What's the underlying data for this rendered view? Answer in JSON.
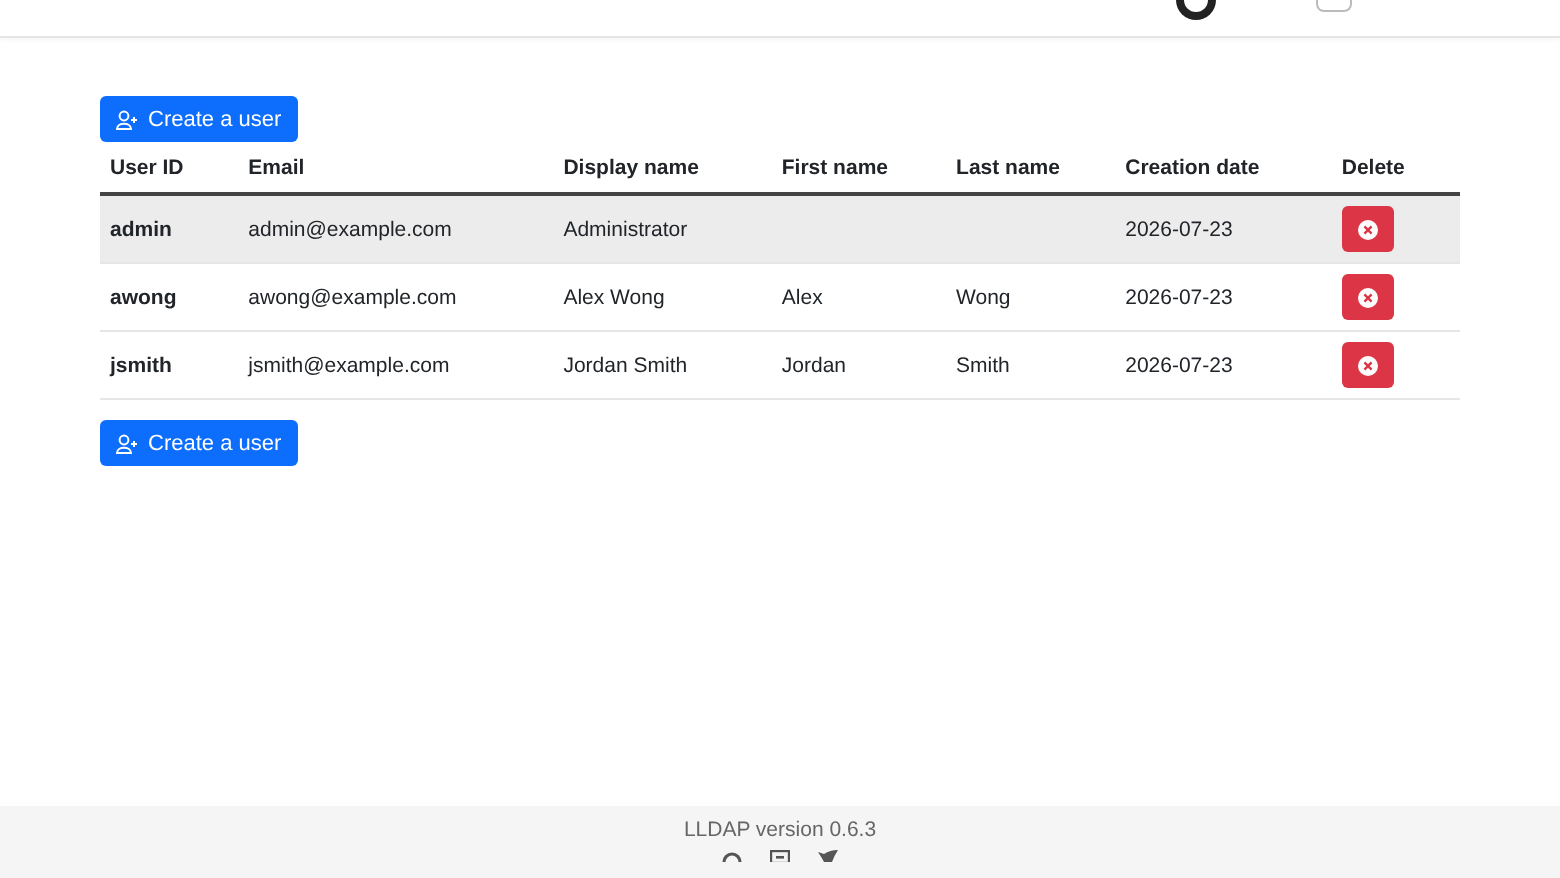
{
  "header": {
    "toggle": {
      "on": false
    }
  },
  "actions": {
    "create_top": "Create a user",
    "create_bottom": "Create a user"
  },
  "table": {
    "columns": [
      "User ID",
      "Email",
      "Display name",
      "First name",
      "Last name",
      "Creation date",
      "Delete"
    ],
    "rows": [
      {
        "user_id": "admin",
        "email": "admin@example.com",
        "display_name": "Administrator",
        "first_name": "",
        "last_name": "",
        "creation_date": "2026-07-23",
        "selected": true
      },
      {
        "user_id": "awong",
        "email": "awong@example.com",
        "display_name": "Alex Wong",
        "first_name": "Alex",
        "last_name": "Wong",
        "creation_date": "2026-07-23",
        "selected": false
      },
      {
        "user_id": "jsmith",
        "email": "jsmith@example.com",
        "display_name": "Jordan Smith",
        "first_name": "Jordan",
        "last_name": "Smith",
        "creation_date": "2026-07-23",
        "selected": false
      }
    ]
  },
  "footer": {
    "version": "LLDAP version 0.6.3"
  }
}
